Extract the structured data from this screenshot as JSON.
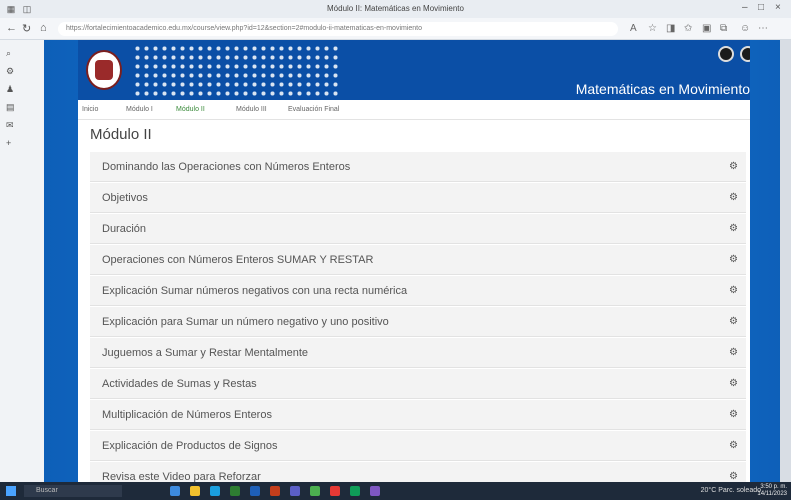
{
  "browser": {
    "window_title": "Módulo II: Matemáticas en Movimiento",
    "url": "https://fortalecimientoacademico.edu.mx/course/view.php?id=12&section=2#modulo-ii-matematicas-en-movimiento"
  },
  "course": {
    "title": "Matemáticas en Movimiento"
  },
  "tabs": [
    {
      "label": "Inicio"
    },
    {
      "label": "Módulo I"
    },
    {
      "label": "Módulo II"
    },
    {
      "label": "Módulo III"
    },
    {
      "label": "Evaluación Final"
    }
  ],
  "module": {
    "title": "Módulo II",
    "items": [
      {
        "label": "Dominando las Operaciones con Números Enteros"
      },
      {
        "label": "Objetivos"
      },
      {
        "label": "Duración"
      },
      {
        "label": "Operaciones con Números Enteros SUMAR Y RESTAR"
      },
      {
        "label": "Explicación Sumar números negativos con una recta numérica"
      },
      {
        "label": "Explicación para Sumar un número negativo y uno positivo"
      },
      {
        "label": "Juguemos a Sumar y Restar Mentalmente"
      },
      {
        "label": "Actividades de Sumas y Restas"
      },
      {
        "label": "Multiplicación de Números Enteros"
      },
      {
        "label": "Explicación de Productos de Signos"
      },
      {
        "label": "Revisa este Video para Reforzar"
      }
    ]
  },
  "taskbar": {
    "search_placeholder": "Buscar",
    "weather": "20°C Parc. soleado",
    "time": "3:50 p. m.",
    "date": "14/11/2023"
  },
  "colors": {
    "banner_blue": "#0b4fa6",
    "page_blue": "#1a7ad8",
    "active_tab": "#3a8a3a"
  }
}
